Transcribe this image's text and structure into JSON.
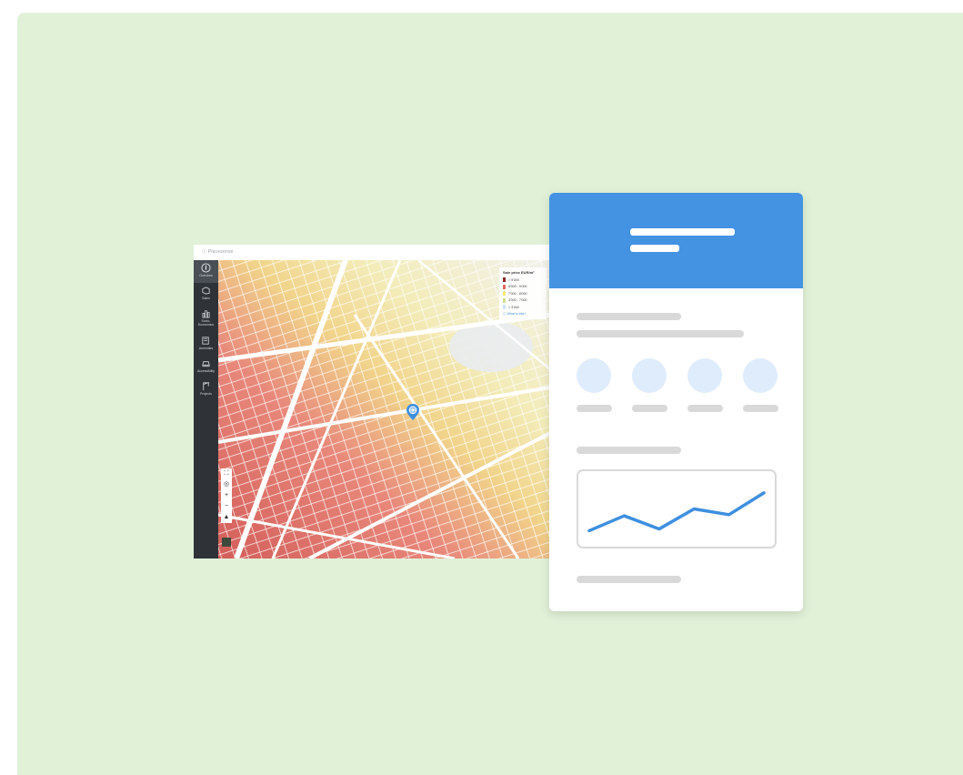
{
  "app": {
    "logo_text": "ⓘ Placesense",
    "nav_items": [
      {
        "label": "Overview",
        "icon": "info-icon"
      },
      {
        "label": "Sales",
        "icon": "map-icon"
      },
      {
        "label": "Socio-\nEconomics",
        "icon": "chart-icon"
      },
      {
        "label": "Amenities",
        "icon": "amenities-icon"
      },
      {
        "label": "Accessibility",
        "icon": "car-icon"
      },
      {
        "label": "Projects",
        "icon": "crane-icon"
      }
    ],
    "legend": {
      "title": "Sale price EUR/m²",
      "items": [
        {
          "label": "> 9'000",
          "color": "#8e2a2a"
        },
        {
          "label": "8'000 - 9'000",
          "color": "#e06a5f"
        },
        {
          "label": "7'000 - 8'000",
          "color": "#f6e97c"
        },
        {
          "label": "3'000 - 7'000",
          "color": "#cfe08a"
        },
        {
          "label": "< 3'000",
          "color": "#cfe3f5"
        }
      ],
      "link": "ⓘ What is this?"
    },
    "map_controls": [
      "⛶",
      "◎",
      "+",
      "−",
      "▲"
    ]
  },
  "card": {
    "header_color": "#4393e2",
    "circle_color": "#dfecfb",
    "line_color": "#3e8fe0",
    "chart_data": {
      "type": "line",
      "title": "",
      "xlabel": "",
      "ylabel": "",
      "values": [
        0.12,
        0.38,
        0.15,
        0.5,
        0.4,
        0.78
      ]
    }
  }
}
